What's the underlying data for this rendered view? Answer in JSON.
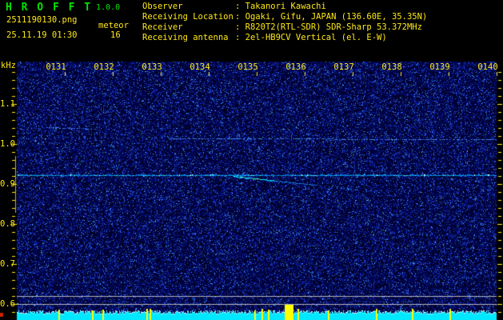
{
  "header": {
    "app_title": "H R O F F T",
    "version": "1.0.0",
    "filename": "2511190130.png",
    "mode": "meteor",
    "datetime": "25.11.19 01:30",
    "event_count": "16",
    "info_rows": [
      {
        "label": "Observer",
        "value": "Takanori Kawachi"
      },
      {
        "label": "Receiving Location",
        "value": "Ogaki, Gifu, JAPAN (136.60E, 35.35N)"
      },
      {
        "label": "Receiver",
        "value": "R820T2(RTL-SDR) SDR-Sharp 53.372MHz"
      },
      {
        "label": "Receiving antenna",
        "value": "2el-HB9CV Vertical (el. E-W)"
      }
    ]
  },
  "axes": {
    "freq_unit": "kHz",
    "freq_tick_labels": [
      "1.1",
      "1.0",
      "0.9",
      "0.8",
      "0.7",
      "0.6"
    ],
    "time_tick_labels": [
      "0131",
      "0132",
      "0133",
      "0134",
      "0135",
      "0136",
      "0137",
      "0138",
      "0139",
      "0140"
    ]
  },
  "colors": {
    "background": "#000000",
    "label_yellow": "#ffe818",
    "title_green": "#00e400",
    "meter_cyan": "#00e8ff",
    "meter_tip": "#d8ffff",
    "event_yellow": "#ffff00",
    "grid_gray": "#b4b4bc",
    "marker_gray": "#a8a8a8",
    "corner_red": "#cc2200"
  },
  "chart_data": {
    "type": "heatmap",
    "title": "HROFFT 1.0.0 radio meteor observation spectrogram",
    "ylabel": "kHz",
    "ylim": [
      0.56,
      1.21
    ],
    "y_ticks": [
      1.1,
      1.0,
      0.9,
      0.8,
      0.7,
      0.6
    ],
    "y_minor_step_khz": 0.02,
    "x_start_label": "0130",
    "x_minutes_span": 10,
    "x_tick_labels": [
      "0131",
      "0132",
      "0133",
      "0134",
      "0135",
      "0136",
      "0137",
      "0138",
      "0139",
      "0140"
    ],
    "meteor_count": 16,
    "features": [
      {
        "kind": "carrier-line",
        "freq_khz": 0.922,
        "t_start_min": 0,
        "t_end_min": 10,
        "intensity": "bright"
      },
      {
        "kind": "faint-trace",
        "freq_start_khz": 1.043,
        "freq_end_khz": 1.039,
        "t_start_min": 0.62,
        "t_end_min": 1.65,
        "intensity": "faint"
      },
      {
        "kind": "faint-trace",
        "freq_start_khz": 1.014,
        "freq_end_khz": 1.013,
        "t_start_min": 3.2,
        "t_end_min": 10,
        "intensity": "faint"
      },
      {
        "kind": "doppler-streak",
        "freq_start_khz": 0.92,
        "freq_end_khz": 0.886,
        "t_start_min": 4.52,
        "t_end_min": 7.12,
        "intensity": "medium-bright"
      },
      {
        "kind": "detection-band-marker",
        "freq_start_khz": 0.97,
        "freq_end_khz": 0.828,
        "t_min": 0
      },
      {
        "kind": "level-line",
        "freq_khz": 0.62
      },
      {
        "kind": "level-line",
        "freq_khz": 0.6
      }
    ],
    "noise_meter_events_min": [
      {
        "t_min": 0.87
      },
      {
        "t_min": 1.57
      },
      {
        "t_min": 1.78
      },
      {
        "t_min": 2.7
      },
      {
        "t_min": 2.77
      },
      {
        "t_min": 4.95
      },
      {
        "t_min": 5.1
      },
      {
        "t_min": 5.23
      },
      {
        "t_min": 5.58,
        "dur_min": 0.18,
        "strong": true
      },
      {
        "t_min": 5.85
      },
      {
        "t_min": 6.48
      },
      {
        "t_min": 7.48
      },
      {
        "t_min": 8.23
      },
      {
        "t_min": 9.02
      }
    ]
  }
}
